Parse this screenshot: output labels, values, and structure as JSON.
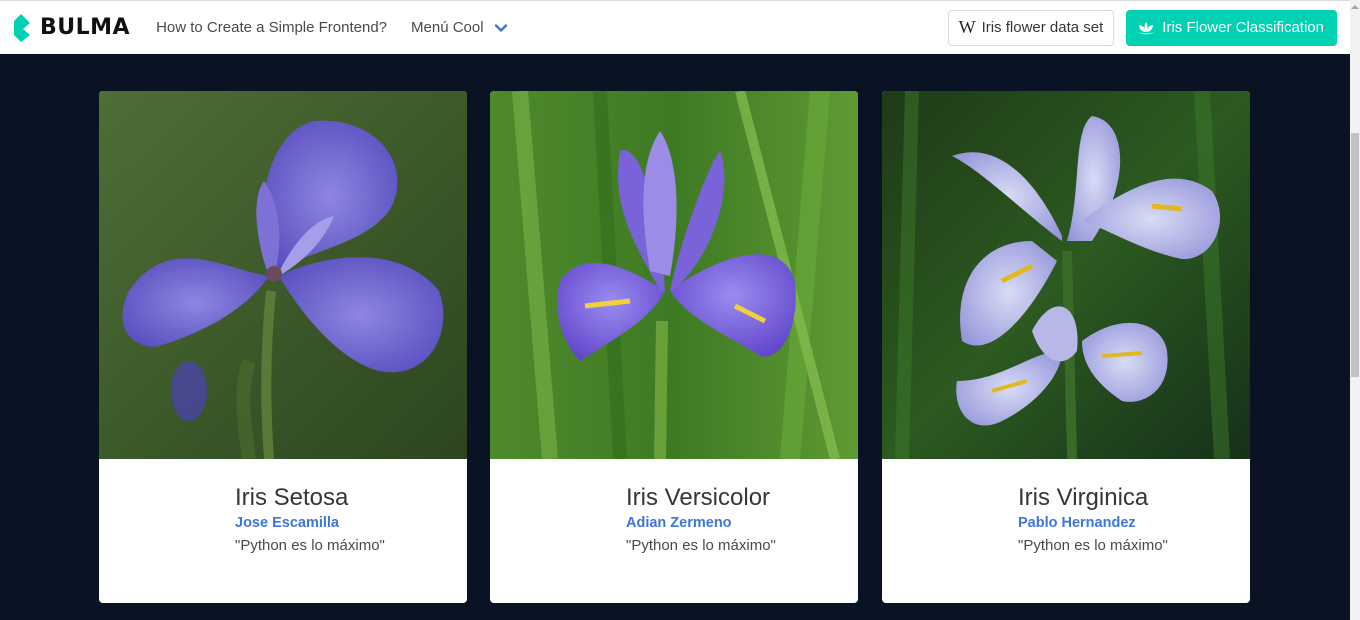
{
  "navbar": {
    "brand": "BULMA",
    "link1": "How to Create a Simple Frontend?",
    "menu": "Menú Cool",
    "btn_wiki": "Iris flower data set",
    "btn_wiki_icon": "wikipedia-w-icon",
    "btn_primary": "Iris Flower Classification",
    "btn_primary_icon": "lotus-flower-icon"
  },
  "colors": {
    "primary": "#00d1b2",
    "link": "#3e76d8",
    "background": "#0a1323"
  },
  "cards": [
    {
      "title": "Iris Setosa",
      "author": "Jose Escamilla",
      "quote": "\"Python es lo máximo\""
    },
    {
      "title": "Iris Versicolor",
      "author": "Adian Zermeno",
      "quote": "\"Python es lo máximo\""
    },
    {
      "title": "Iris Virginica",
      "author": "Pablo Hernandez",
      "quote": "\"Python es lo máximo\""
    }
  ]
}
